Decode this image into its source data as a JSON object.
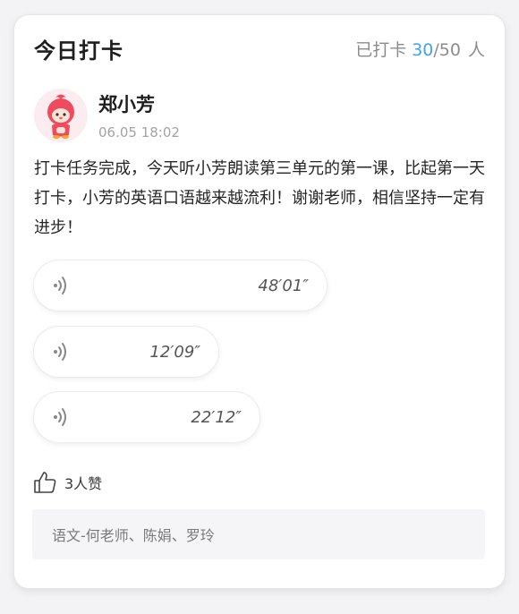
{
  "header": {
    "title": "今日打卡",
    "stat_prefix": "已打卡",
    "done": "30",
    "separator": "/",
    "total": "50",
    "unit": "人"
  },
  "post": {
    "user_name": "郑小芳",
    "time": "06.05 18:02",
    "content": "打卡任务完成，今天听小芳朗读第三单元的第一课，比起第一天打卡，小芳的英语口语越来越流利！谢谢老师，相信坚持一定有进步！"
  },
  "voices": [
    {
      "duration": "48′01″"
    },
    {
      "duration": "12′09″"
    },
    {
      "duration": "22′12″"
    }
  ],
  "likes": {
    "count_label": "3人赞",
    "names": "语文-何老师、陈娟、罗玲"
  },
  "colors": {
    "accent": "#3fa3ef",
    "avatar_red": "#f04a5f"
  }
}
